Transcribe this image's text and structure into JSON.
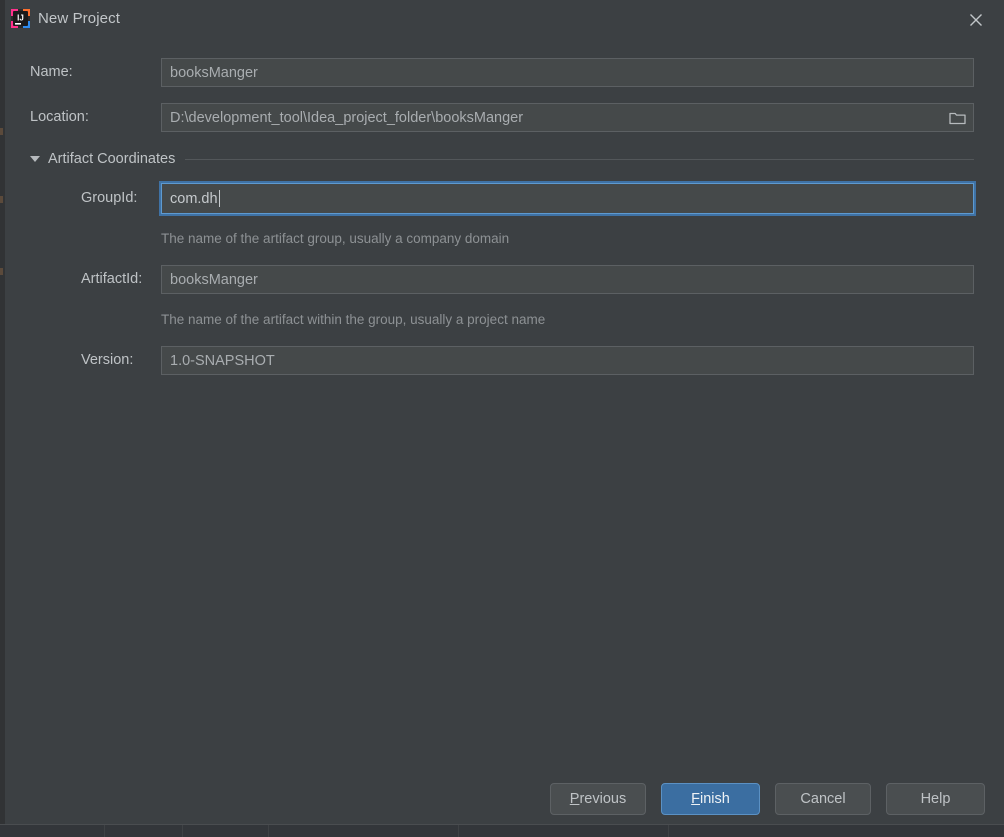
{
  "window": {
    "title": "New Project",
    "app_icon": "intellij-idea-icon",
    "close_icon": "close-icon",
    "background_color": "#3c4043",
    "accent_color": "#3b6ea1",
    "focus_border_color": "#5e9ad0"
  },
  "form": {
    "name": {
      "label": "Name:",
      "value": "booksManger",
      "placeholder": ""
    },
    "location": {
      "label": "Location:",
      "value": "D:\\development_tool\\Idea_project_folder\\booksManger",
      "placeholder": "",
      "browse_icon": "folder-icon"
    },
    "artifact_group": {
      "title": "Artifact Coordinates",
      "expanded": true,
      "toggle_icon": "chevron-down-icon"
    },
    "group_id": {
      "label": "GroupId:",
      "value": "com.dh",
      "placeholder": "",
      "focused": true,
      "hint": "The name of the artifact group, usually a company domain"
    },
    "artifact_id": {
      "label": "ArtifactId:",
      "value": "booksManger",
      "placeholder": "",
      "hint": "The name of the artifact within the group, usually a project name"
    },
    "version": {
      "label": "Version:",
      "value": "1.0-SNAPSHOT",
      "placeholder": ""
    }
  },
  "buttons": {
    "previous": {
      "mnemonic": "P",
      "rest": "revious"
    },
    "finish": {
      "mnemonic": "F",
      "rest": "inish",
      "is_default": true
    },
    "cancel": {
      "label": "Cancel"
    },
    "help": {
      "label": "Help"
    }
  }
}
